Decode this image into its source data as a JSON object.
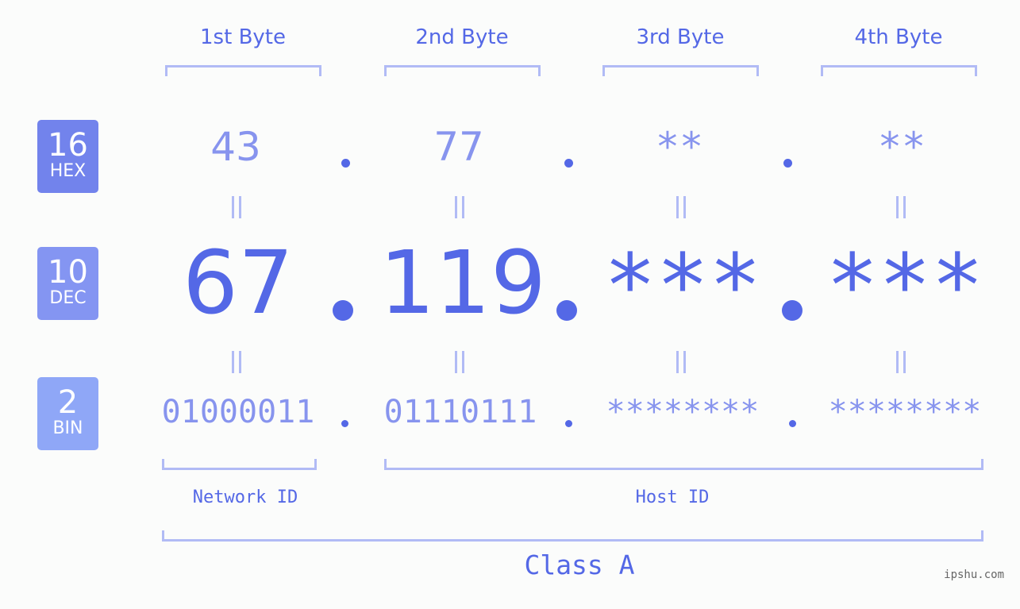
{
  "byte_headers": [
    "1st Byte",
    "2nd Byte",
    "3rd Byte",
    "4th Byte"
  ],
  "bases": {
    "hex": {
      "number": "16",
      "label": "HEX"
    },
    "dec": {
      "number": "10",
      "label": "DEC"
    },
    "bin": {
      "number": "2",
      "label": "BIN"
    }
  },
  "hex_values": [
    "43",
    "77",
    "**",
    "**"
  ],
  "dec_values": [
    "67",
    "119",
    "***",
    "***"
  ],
  "bin_values": [
    "01000011",
    "01110111",
    "********",
    "********"
  ],
  "network_id_label": "Network ID",
  "host_id_label": "Host ID",
  "class_label": "Class A",
  "watermark": "ipshu.com",
  "colors": {
    "accent": "#5468e6",
    "light_value": "#8794ee",
    "bracket": "#b1bbf5",
    "hex_badge": "#7283ec",
    "dec_badge": "#8495f2",
    "bin_badge": "#8fa7f7",
    "background": "#fbfcfb"
  }
}
